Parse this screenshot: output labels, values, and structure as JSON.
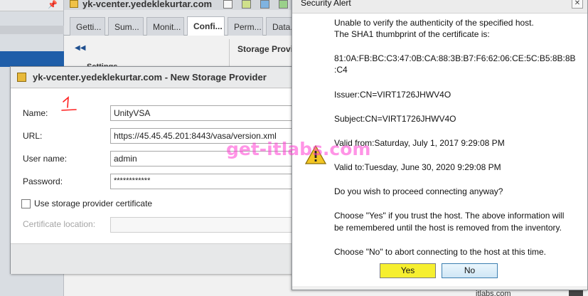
{
  "vcenter": {
    "title": "yk-vcenter.yedeklekurtar.com",
    "tabs": [
      "Getti...",
      "Sum...",
      "Monit...",
      "Confi...",
      "Perm...",
      "Data..."
    ],
    "active_tab_index": 3,
    "settings_label": "Settings",
    "storage_providers_label": "Storage Provid",
    "bottom_fragment": "itlabs.com"
  },
  "new_storage_provider": {
    "title": "yk-vcenter.yedeklekurtar.com - New Storage Provider",
    "annotation": "1",
    "fields": {
      "name_label": "Name:",
      "name_value": "UnityVSA",
      "url_label": "URL:",
      "url_value": "https://45.45.45.201:8443/vasa/version.xml",
      "username_label": "User name:",
      "username_value": "admin",
      "password_label": "Password:",
      "password_value": "************",
      "use_cert_label": "Use storage provider certificate",
      "use_cert_checked": false,
      "cert_location_label": "Certificate location:",
      "cert_location_value": ""
    }
  },
  "security_alert": {
    "title": "Security Alert",
    "close_icon": "close-icon",
    "warning_icon": "warning-icon",
    "line1": "Unable to verify the authenticity of the specified host.",
    "line2": "The SHA1 thumbprint of the certificate is:",
    "thumbprint1": "81:0A:FB:BC:C3:47:0B:CA:88:3B:B7:F6:62:06:CE:5C:B5:8B:8B",
    "thumbprint2": ":C4",
    "issuer": "Issuer:CN=VIRT1726JHWV4O",
    "subject": "Subject:CN=VIRT1726JHWV4O",
    "valid_from": "Valid from:Saturday, July 1, 2017 9:29:08 PM",
    "valid_to": "Valid to:Tuesday, June 30, 2020 9:29:08 PM",
    "question": "Do you wish to proceed connecting anyway?",
    "choose_yes1": "Choose \"Yes\" if you trust the host. The above information will",
    "choose_yes2": "be remembered until the host is removed from the inventory.",
    "choose_no": "Choose \"No\" to abort connecting to the host at this time.",
    "yes_label": "Yes",
    "no_label": "No"
  },
  "watermark": "get-itlabs.com"
}
